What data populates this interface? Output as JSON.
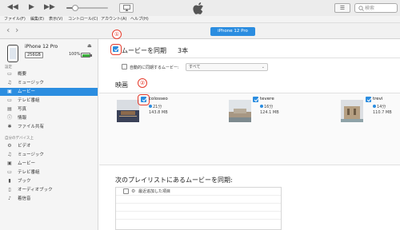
{
  "toolbar": {
    "prev_icon": "rewind-icon",
    "play_icon": "play-icon",
    "next_icon": "fast-forward-icon",
    "volume_level_pct": 22,
    "search_placeholder": "検索"
  },
  "menubar": {
    "items": [
      "ファイル(F)",
      "編集(E)",
      "表示(V)",
      "コントロール(C)",
      "アカウント(A)",
      "ヘルプ(H)"
    ]
  },
  "navbar": {
    "back": "‹",
    "forward": "›",
    "device_button": "iPhone 12 Pro"
  },
  "sidebar": {
    "device_name": "iPhone 12 Pro",
    "capacity": "256GB",
    "battery_pct_text": "100%",
    "battery_level": 1.0,
    "settings_header": "設定",
    "settings_items": [
      {
        "label": "概要",
        "icon": "summary-icon"
      },
      {
        "label": "ミュージック",
        "icon": "music-note-icon"
      },
      {
        "label": "ムービー",
        "icon": "film-icon"
      },
      {
        "label": "テレビ番組",
        "icon": "tv-icon"
      },
      {
        "label": "写真",
        "icon": "photo-icon"
      },
      {
        "label": "情報",
        "icon": "info-icon"
      },
      {
        "label": "ファイル共有",
        "icon": "apps-icon"
      }
    ],
    "device_header": "自分のデバイス上",
    "device_items": [
      {
        "label": "ビデオ",
        "icon": "gear-icon"
      },
      {
        "label": "ミュージック",
        "icon": "music-note-icon"
      },
      {
        "label": "ムービー",
        "icon": "film-icon"
      },
      {
        "label": "テレビ番組",
        "icon": "tv-icon"
      },
      {
        "label": "ブック",
        "icon": "book-icon"
      },
      {
        "label": "オーディオブック",
        "icon": "audiobook-icon"
      },
      {
        "label": "着信音",
        "icon": "bell-icon"
      }
    ],
    "active_index": 2
  },
  "content": {
    "marker1": "①",
    "marker2": "②",
    "sync_label": "ムービーを同期",
    "sync_count": "3本",
    "sync_checked": true,
    "auto_include_label": "自動的に同期するムービー:",
    "auto_include_value": "すべて",
    "movies_header": "映画",
    "movies": [
      {
        "title": "colosseo",
        "duration": "21分",
        "size": "143.8 MB",
        "checked": true
      },
      {
        "title": "tevere",
        "duration": "16分",
        "size": "124.1 MB",
        "checked": true
      },
      {
        "title": "trevi",
        "duration": "14分",
        "size": "110.7 MB",
        "checked": true
      }
    ],
    "playlists_header": "次のプレイリストにあるムービーを同期:",
    "playlists": [
      {
        "label": "最近追加した項目",
        "checked": false,
        "icon": "gear-icon"
      }
    ]
  }
}
